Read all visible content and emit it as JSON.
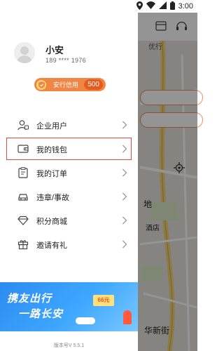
{
  "status_bar": {
    "time": "3:00"
  },
  "user": {
    "name": "小安",
    "phone": "189 **** 1976"
  },
  "credit": {
    "label": "安行信用",
    "score": "500"
  },
  "menu": [
    {
      "label": "企业用户",
      "icon": "user-card-icon"
    },
    {
      "label": "我的钱包",
      "icon": "wallet-icon",
      "highlighted": true
    },
    {
      "label": "我的订单",
      "icon": "order-clipboard-icon"
    },
    {
      "label": "违章/事故",
      "icon": "car-icon"
    },
    {
      "label": "积分商城",
      "icon": "diamond-icon"
    },
    {
      "label": "邀请有礼",
      "icon": "gift-icon"
    }
  ],
  "banner": {
    "line1": "携友出行",
    "line2": "一路长安",
    "coupon": "66元"
  },
  "version": "版本号V 5.5.1",
  "map": {
    "tab": "优行",
    "labels": [
      "地",
      "酒店",
      "华新街"
    ]
  },
  "colors": {
    "accent": "#f08645",
    "highlight_border": "#e24b3b",
    "banner": "#2b8bf0"
  }
}
